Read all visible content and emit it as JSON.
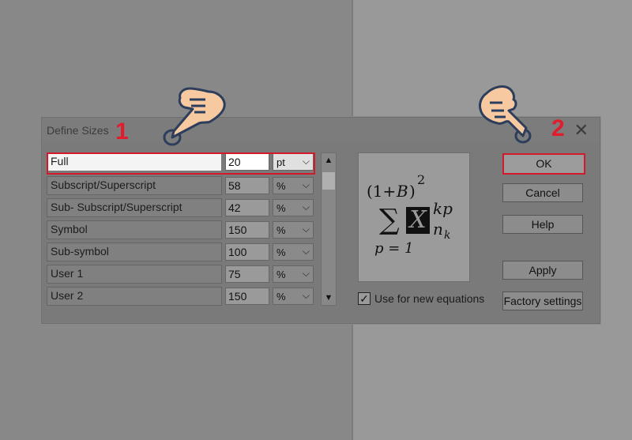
{
  "dialog": {
    "title": "Define Sizes",
    "close_glyph": "✕"
  },
  "sizes": {
    "rows": [
      {
        "name": "Full",
        "value": "20",
        "unit": "pt",
        "selected": true
      },
      {
        "name": "Subscript/Superscript",
        "value": "58",
        "unit": "%"
      },
      {
        "name": "Sub- Subscript/Superscript",
        "value": "42",
        "unit": "%"
      },
      {
        "name": "Symbol",
        "value": "150",
        "unit": "%"
      },
      {
        "name": "Sub-symbol",
        "value": "100",
        "unit": "%"
      },
      {
        "name": "User 1",
        "value": "75",
        "unit": "%"
      },
      {
        "name": "User 2",
        "value": "150",
        "unit": "%"
      }
    ],
    "chevron_glyph": "⌵"
  },
  "scrollbar": {
    "up_glyph": "▲",
    "down_glyph": "▼"
  },
  "preview": {
    "open_paren": "(1+",
    "b": "B",
    "close_paren": ")",
    "pow": "2",
    "sigma": "∑",
    "x": "X",
    "kp": "kp",
    "n": "n",
    "k": "k",
    "lower": "p = 1"
  },
  "options": {
    "use_for_new_label": "Use for new equations",
    "use_for_new_checked": true,
    "check_glyph": "✓"
  },
  "buttons": {
    "ok": "OK",
    "cancel": "Cancel",
    "help": "Help",
    "apply": "Apply",
    "factory": "Factory settings"
  },
  "annotations": {
    "step1": "1",
    "step2": "2",
    "highlight_color": "#e21b2d"
  }
}
